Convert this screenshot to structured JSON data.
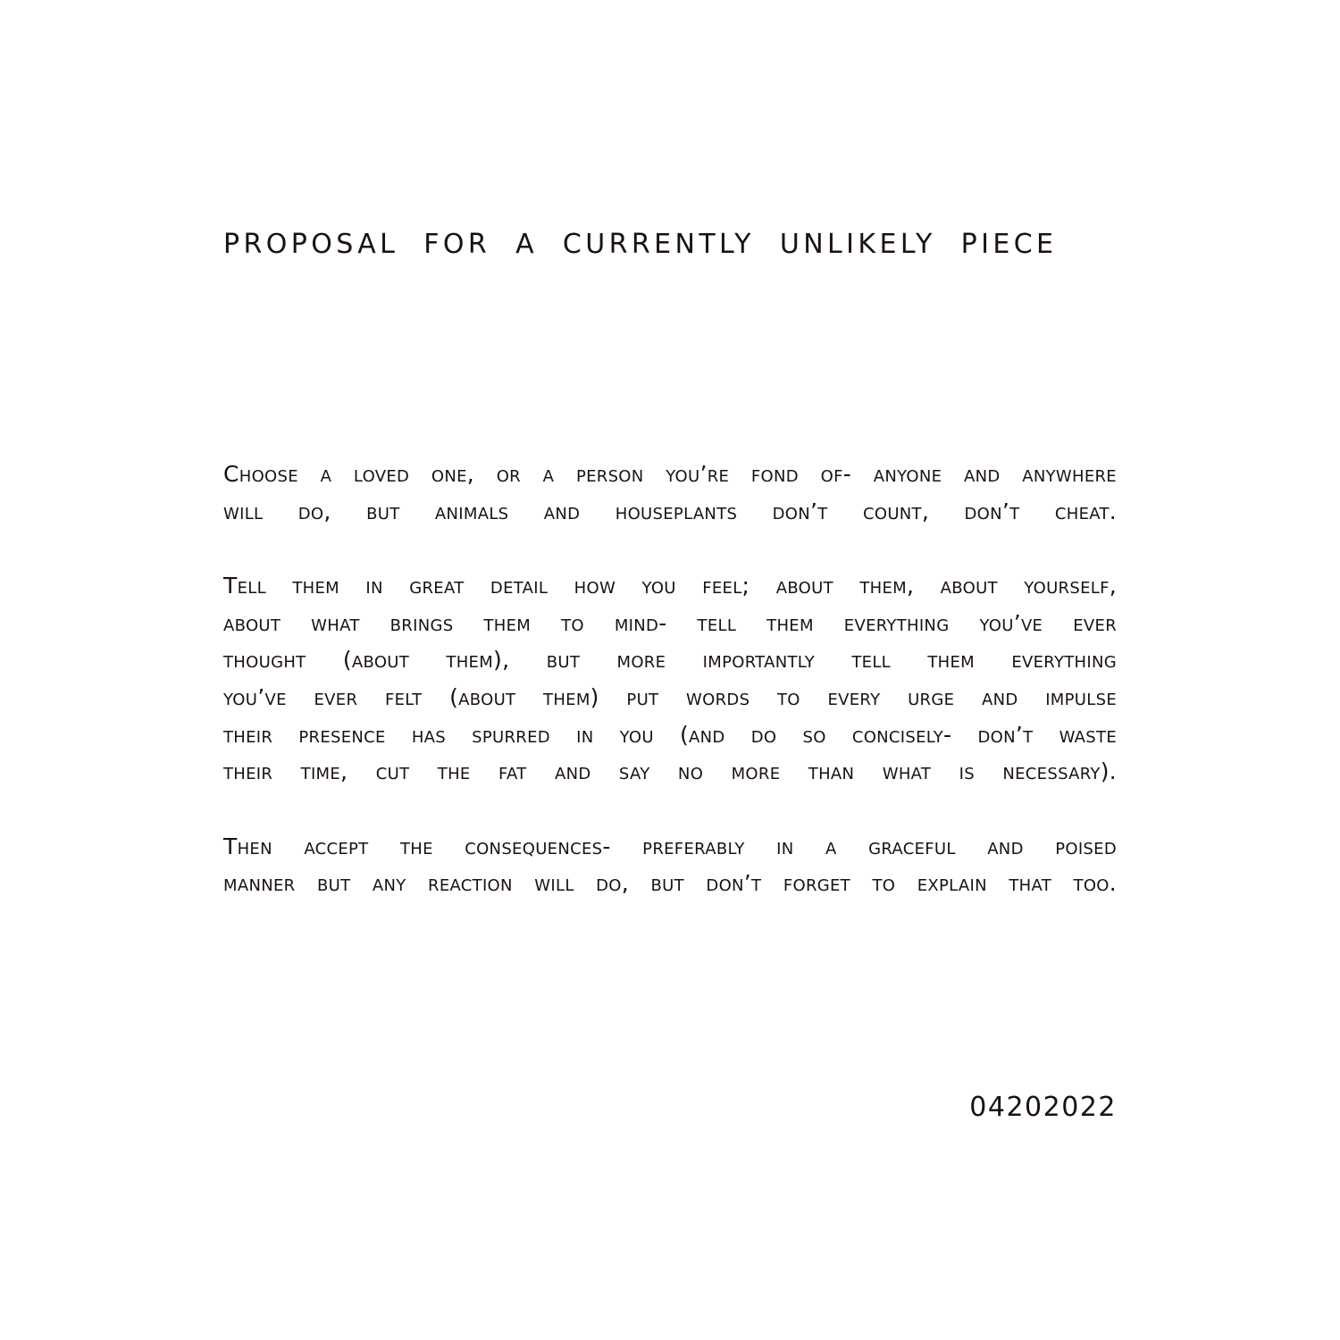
{
  "document": {
    "title": "PROPOSAL FOR A CURRENTLY UNLIKELY PIECE",
    "paragraphs": [
      {
        "lines": [
          "Choose a loved one, or a person you’re fond of- anyone and anywhere",
          "will do, but animals and houseplants don’t count, don’t cheat."
        ]
      },
      {
        "lines": [
          "Tell them in great detail how you feel; about them, about yourself,",
          "about what brings them to mind- tell them everything you’ve ever",
          "thought (about them), but more importantly tell them everything",
          "you’ve ever felt (about them) put words to every urge and impulse",
          "their presence has spurred in you (and do so concisely- don’t waste",
          "their time, cut the fat and say no more than what is necessary)."
        ]
      },
      {
        "lines": [
          "Then accept the consequences- preferably in a graceful and poised",
          "manner but any reaction will do, but don’t forget to explain that too."
        ]
      }
    ],
    "date": "04202022",
    "colors": {
      "text": "#1a1210",
      "background": "#ffffff"
    }
  }
}
